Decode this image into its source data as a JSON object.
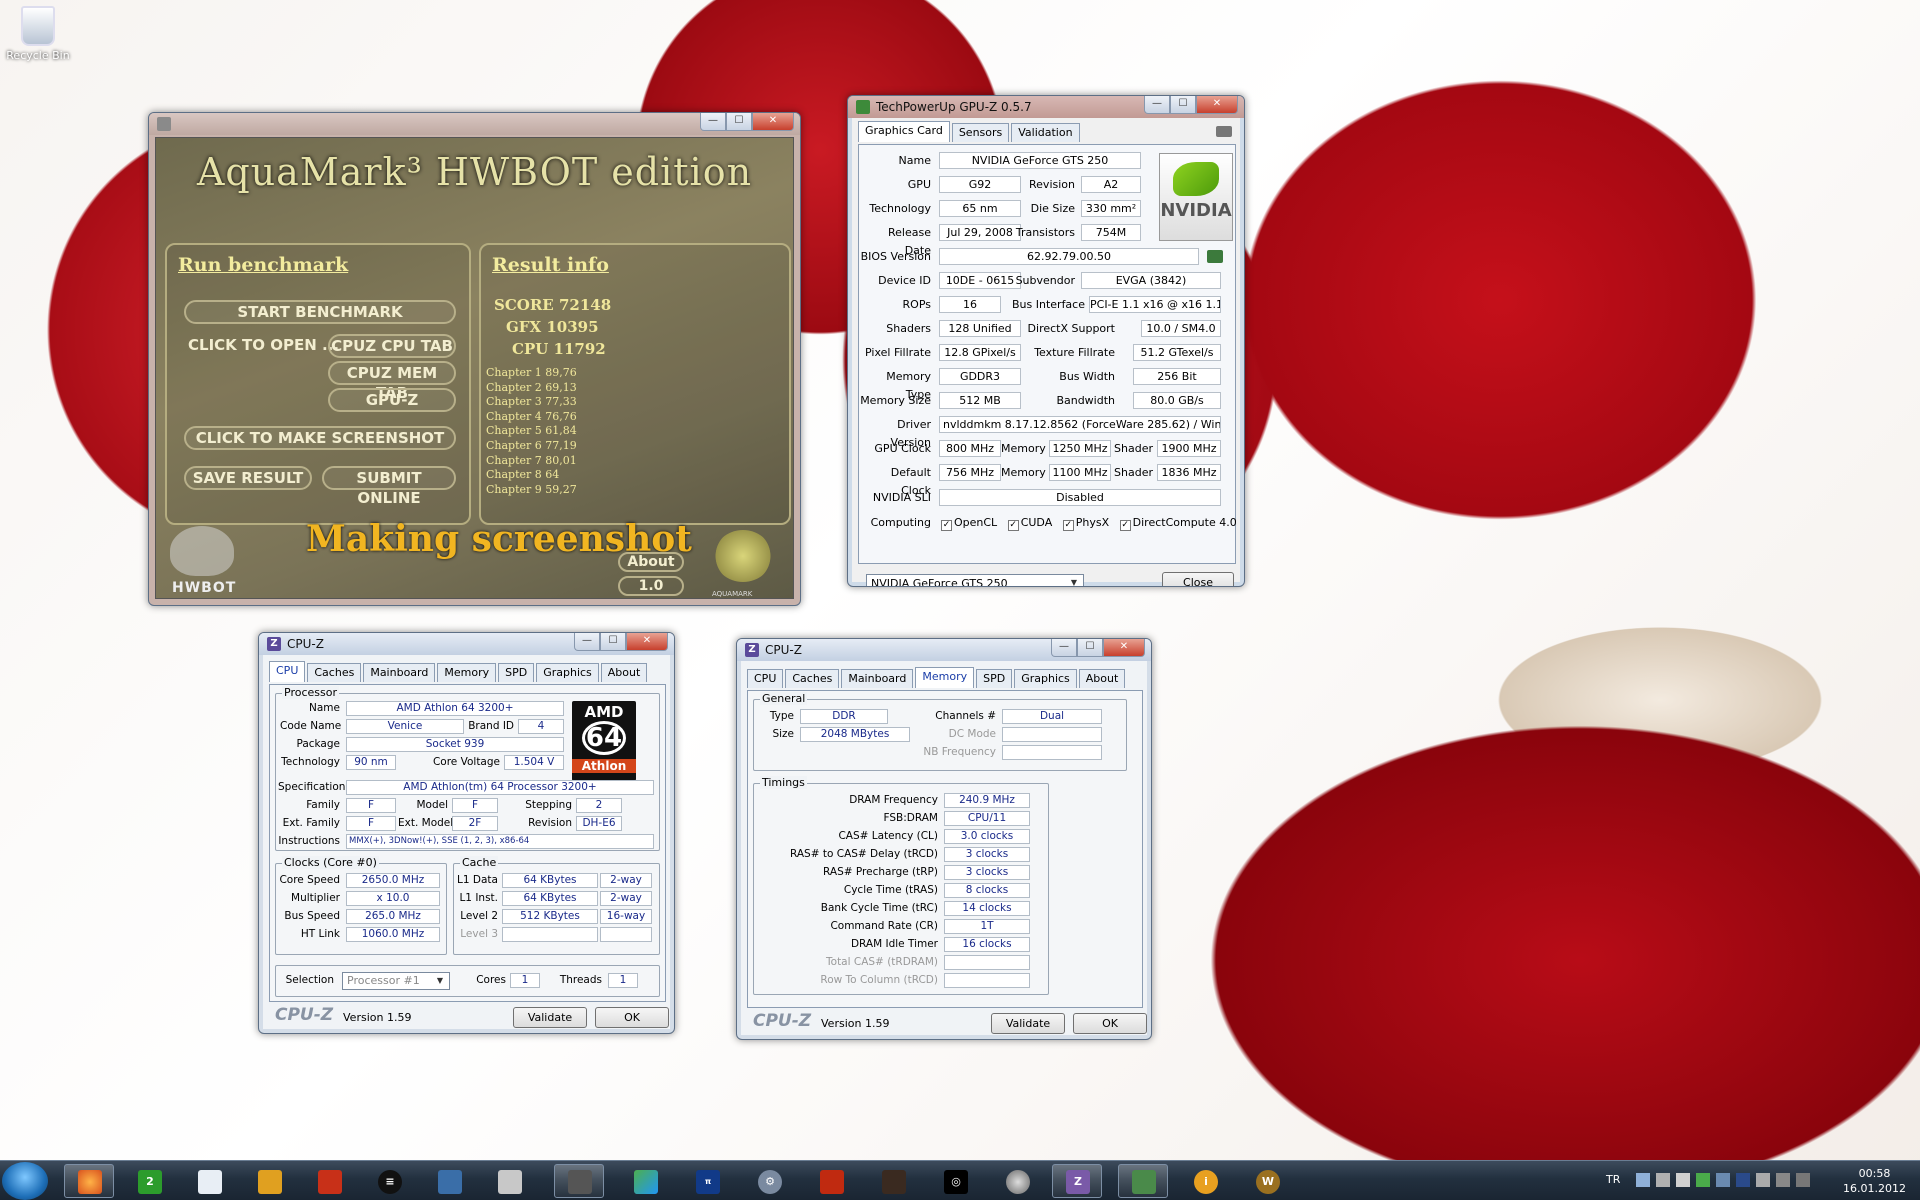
{
  "desktop": {
    "recycle_bin": "Recycle Bin"
  },
  "aquamark": {
    "title": "AquaMark³ HWBOT edition",
    "run_header": "Run benchmark",
    "result_header": "Result info",
    "start": "START BENCHMARK",
    "click_open": "CLICK TO OPEN ...",
    "cpuz_cpu": "CPUZ CPU TAB",
    "cpuz_mem": "CPUZ MEM TAB",
    "gpuz": "GPU-Z",
    "screenshot": "CLICK TO MAKE SCREENSHOT",
    "save": "SAVE RESULT",
    "submit": "SUBMIT ONLINE",
    "score": "SCORE 72148",
    "gfx": "GFX 10395",
    "cpu": "CPU 11792",
    "chapters": [
      "Chapter 1  89,76",
      "Chapter 2  69,13",
      "Chapter 3  77,33",
      "Chapter 4  76,76",
      "Chapter 5  61,84",
      "Chapter 6  77,19",
      "Chapter 7  80,01",
      "Chapter 8  64",
      "Chapter 9  59,27"
    ],
    "status": "Making screenshot",
    "about": "About",
    "version": "1.0",
    "hwbot": "HWBOT",
    "logo": "AQUAMARK"
  },
  "gpuz": {
    "title": "TechPowerUp GPU-Z 0.5.7",
    "tabs": [
      "Graphics Card",
      "Sensors",
      "Validation"
    ],
    "name_l": "Name",
    "name": "NVIDIA GeForce GTS 250",
    "gpu_l": "GPU",
    "gpu": "G92",
    "rev_l": "Revision",
    "rev": "A2",
    "tech_l": "Technology",
    "tech": "65 nm",
    "die_l": "Die Size",
    "die": "330 mm²",
    "rel_l": "Release Date",
    "rel": "Jul 29, 2008",
    "trans_l": "Transistors",
    "trans": "754M",
    "bios_l": "BIOS Version",
    "bios": "62.92.79.00.50",
    "dev_l": "Device ID",
    "dev": "10DE - 0615",
    "subv_l": "Subvendor",
    "subv": "EVGA (3842)",
    "rops_l": "ROPs",
    "rops": "16",
    "bus_l": "Bus Interface",
    "bus": "PCI-E 1.1 x16 @ x16 1.1",
    "sh_l": "Shaders",
    "sh": "128 Unified",
    "dx_l": "DirectX Support",
    "dx": "10.0 / SM4.0",
    "pf_l": "Pixel Fillrate",
    "pf": "12.8 GPixel/s",
    "tf_l": "Texture Fillrate",
    "tf": "51.2 GTexel/s",
    "mt_l": "Memory Type",
    "mt": "GDDR3",
    "bw_l": "Bus Width",
    "bw": "256 Bit",
    "ms_l": "Memory Size",
    "ms": "512 MB",
    "band_l": "Bandwidth",
    "band": "80.0 GB/s",
    "drv_l": "Driver Version",
    "drv": "nvlddmkm 8.17.12.8562 (ForceWare 285.62) / Win7 64",
    "gc_l": "GPU Clock",
    "gc": "800 MHz",
    "mem_l": "Memory",
    "gmem": "1250 MHz",
    "shd_l": "Shader",
    "gsh": "1900 MHz",
    "dc_l": "Default Clock",
    "dc": "756 MHz",
    "dmem": "1100 MHz",
    "dsh": "1836 MHz",
    "sli_l": "NVIDIA SLI",
    "sli": "Disabled",
    "comp_l": "Computing",
    "comp": [
      "OpenCL",
      "CUDA",
      "PhysX",
      "DirectCompute 4.0"
    ],
    "check": "✓",
    "select": "NVIDIA GeForce GTS 250",
    "close": "Close",
    "nvidia": "NVIDIA"
  },
  "cpuz1": {
    "title": "CPU-Z",
    "tabs": [
      "CPU",
      "Caches",
      "Mainboard",
      "Memory",
      "SPD",
      "Graphics",
      "About"
    ],
    "proc": "Processor",
    "name_l": "Name",
    "name": "AMD Athlon 64 3200+",
    "code_l": "Code Name",
    "code": "Venice",
    "brand_l": "Brand ID",
    "brand": "4",
    "pkg_l": "Package",
    "pkg": "Socket 939",
    "tech_l": "Technology",
    "tech": "90 nm",
    "cv_l": "Core Voltage",
    "cv": "1.504 V",
    "spec_l": "Specification",
    "spec": "AMD Athlon(tm) 64 Processor 3200+",
    "fam_l": "Family",
    "fam": "F",
    "mod_l": "Model",
    "mod": "F",
    "step_l": "Stepping",
    "step": "2",
    "efam_l": "Ext. Family",
    "efam": "F",
    "emod_l": "Ext. Model",
    "emod": "2F",
    "rev_l": "Revision",
    "rev": "DH-E6",
    "ins_l": "Instructions",
    "ins": "MMX(+), 3DNow!(+), SSE (1, 2, 3), x86-64",
    "clocks": "Clocks (Core #0)",
    "cs_l": "Core Speed",
    "cs": "2650.0 MHz",
    "mul_l": "Multiplier",
    "mul": "x 10.0",
    "bs_l": "Bus Speed",
    "bs": "265.0 MHz",
    "ht_l": "HT Link",
    "ht": "1060.0 MHz",
    "cache": "Cache",
    "l1d_l": "L1 Data",
    "l1d": "64 KBytes",
    "l1d_w": "2-way",
    "l1i_l": "L1 Inst.",
    "l1i": "64 KBytes",
    "l1i_w": "2-way",
    "l2_l": "Level 2",
    "l2": "512 KBytes",
    "l2_w": "16-way",
    "l3_l": "Level 3",
    "sel_l": "Selection",
    "sel": "Processor #1",
    "cores_l": "Cores",
    "cores": "1",
    "thr_l": "Threads",
    "thr": "1",
    "brand_footer": "CPU-Z",
    "ver": "Version 1.59",
    "validate": "Validate",
    "ok": "OK",
    "amd": "AMD",
    "amd64": "64",
    "athlon": "Athlon"
  },
  "cpuz2": {
    "title": "CPU-Z",
    "tabs": [
      "CPU",
      "Caches",
      "Mainboard",
      "Memory",
      "SPD",
      "Graphics",
      "About"
    ],
    "general": "General",
    "type_l": "Type",
    "type": "DDR",
    "ch_l": "Channels #",
    "ch": "Dual",
    "size_l": "Size",
    "size": "2048 MBytes",
    "dcm_l": "DC Mode",
    "nb_l": "NB Frequency",
    "timings": "Timings",
    "t_labels": [
      "DRAM Frequency",
      "FSB:DRAM",
      "CAS# Latency (CL)",
      "RAS# to CAS# Delay (tRCD)",
      "RAS# Precharge (tRP)",
      "Cycle Time (tRAS)",
      "Bank Cycle Time (tRC)",
      "Command Rate (CR)",
      "DRAM Idle Timer",
      "Total CAS# (tRDRAM)",
      "Row To Column (tRCD)"
    ],
    "t_values": [
      "240.9 MHz",
      "CPU/11",
      "3.0 clocks",
      "3 clocks",
      "3 clocks",
      "8 clocks",
      "14 clocks",
      "1T",
      "16 clocks",
      "",
      ""
    ],
    "brand_footer": "CPU-Z",
    "ver": "Version 1.59",
    "validate": "Validate",
    "ok": "OK"
  },
  "taskbar": {
    "lang": "TR",
    "time": "00:58",
    "date": "16.01.2012",
    "items": [
      "firefox",
      "2-1",
      "notepad",
      "paint",
      "calc",
      "list",
      "stack",
      "tool",
      "hwbot",
      "chart",
      "superpi",
      "gear",
      "fire",
      "phys",
      "eye",
      "disc",
      "cpuz",
      "gpuz",
      "info",
      "wow"
    ]
  }
}
